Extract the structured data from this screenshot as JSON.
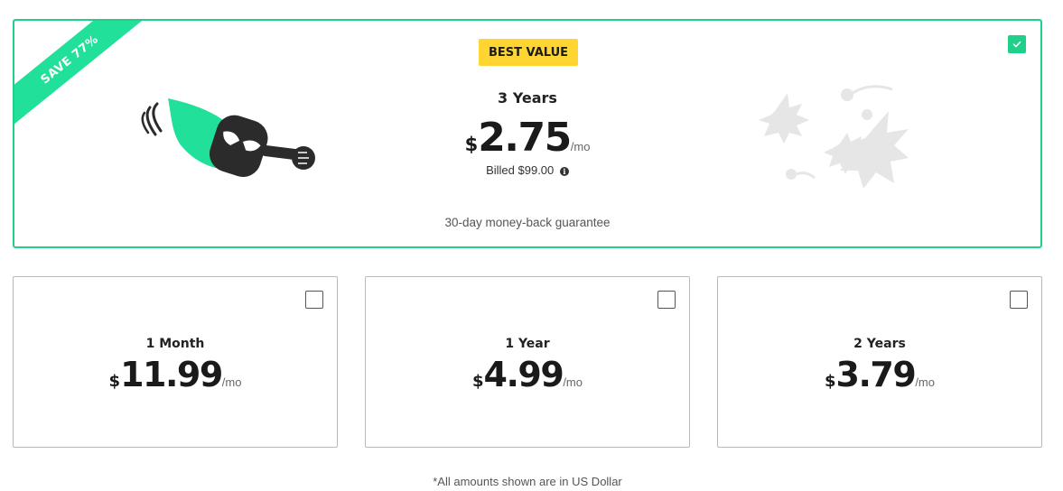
{
  "featured_plan": {
    "ribbon": "SAVE 77%",
    "badge": "BEST VALUE",
    "period": "3 Years",
    "currency_symbol": "$",
    "price": "2.75",
    "per": "/mo",
    "billed": "Billed $99.00",
    "guarantee": "30-day money-back guarantee",
    "selected": true
  },
  "plans": [
    {
      "period": "1 Month",
      "currency_symbol": "$",
      "price": "11.99",
      "per": "/mo",
      "selected": false
    },
    {
      "period": "1 Year",
      "currency_symbol": "$",
      "price": "4.99",
      "per": "/mo",
      "selected": false
    },
    {
      "period": "2 Years",
      "currency_symbol": "$",
      "price": "3.79",
      "per": "/mo",
      "selected": false
    }
  ],
  "footnote": "*All amounts shown are in US Dollar",
  "colors": {
    "accent": "#1fd08a",
    "badge": "#ffd531",
    "ribbon": "#20e09a",
    "illustration_dark": "#2b2b2b",
    "illustration_faded": "#e6e6e6"
  },
  "icons": [
    "hero-mascot-icon",
    "villains-illustration-icon",
    "info-icon",
    "checkmark-icon"
  ]
}
